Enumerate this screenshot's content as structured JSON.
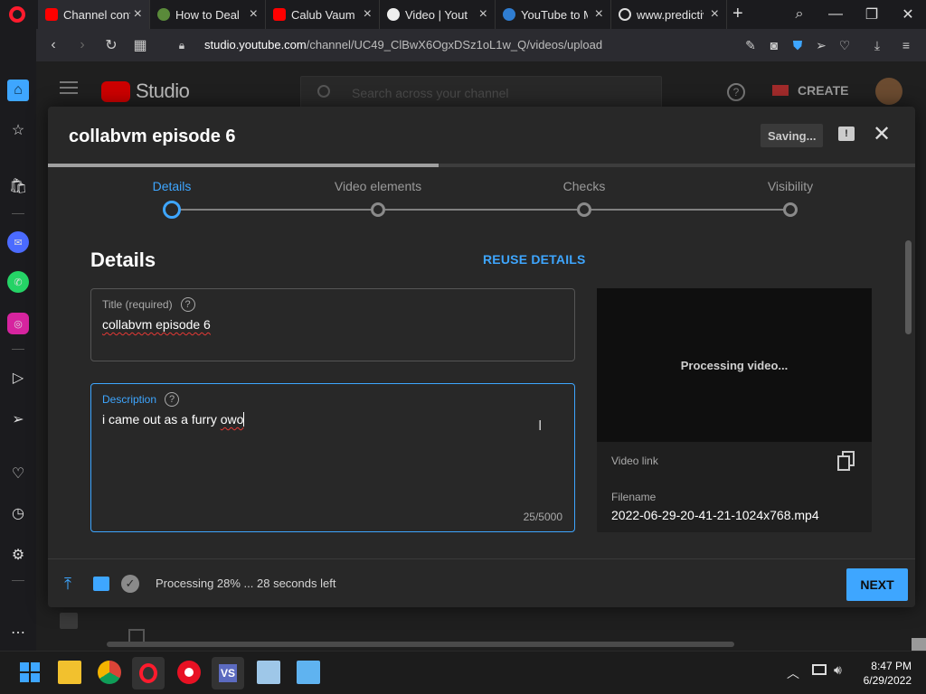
{
  "browser": {
    "tabs": [
      {
        "label": "Channel cont",
        "icon": "youtube-icon",
        "active": true
      },
      {
        "label": "How to Deal",
        "icon": "site-icon"
      },
      {
        "label": "Calub Vaum -",
        "icon": "youtube-icon"
      },
      {
        "label": "Video | Yout",
        "icon": "site-icon"
      },
      {
        "label": "YouTube to M",
        "icon": "site-icon"
      },
      {
        "label": "www.predictiv",
        "icon": "globe-icon"
      }
    ],
    "new_tab": "+",
    "url_host": "studio.youtube.com",
    "url_path": "/channel/UC49_ClBwX6OgxDSz1oL1w_Q/videos/upload"
  },
  "studio": {
    "logo_text": "Studio",
    "search_placeholder": "Search across your channel",
    "create_label": "CREATE"
  },
  "dialog": {
    "title": "collabvm episode 6",
    "saving_label": "Saving...",
    "progress_fraction": 0.45,
    "steps": [
      "Details",
      "Video elements",
      "Checks",
      "Visibility"
    ],
    "active_step": 0,
    "heading": "Details",
    "reuse_label": "REUSE DETAILS",
    "title_field": {
      "label": "Title (required)",
      "value": "collabvm episode 6"
    },
    "description_field": {
      "label": "Description",
      "value_prefix": "i came out as a furry ",
      "value_misspelled": "owo",
      "counter": "25/5000"
    },
    "preview": {
      "processing_text": "Processing video...",
      "video_link_label": "Video link",
      "filename_label": "Filename",
      "filename": "2022-06-29-20-41-21-1024x768.mp4"
    },
    "footer_status": "Processing 28% ... 28 seconds left",
    "next_label": "NEXT"
  },
  "taskbar": {
    "time": "8:47 PM",
    "date": "6/29/2022"
  },
  "colors": {
    "accent": "#3ea6ff",
    "youtube_red": "#ff0000",
    "dialog_bg": "#282828"
  }
}
